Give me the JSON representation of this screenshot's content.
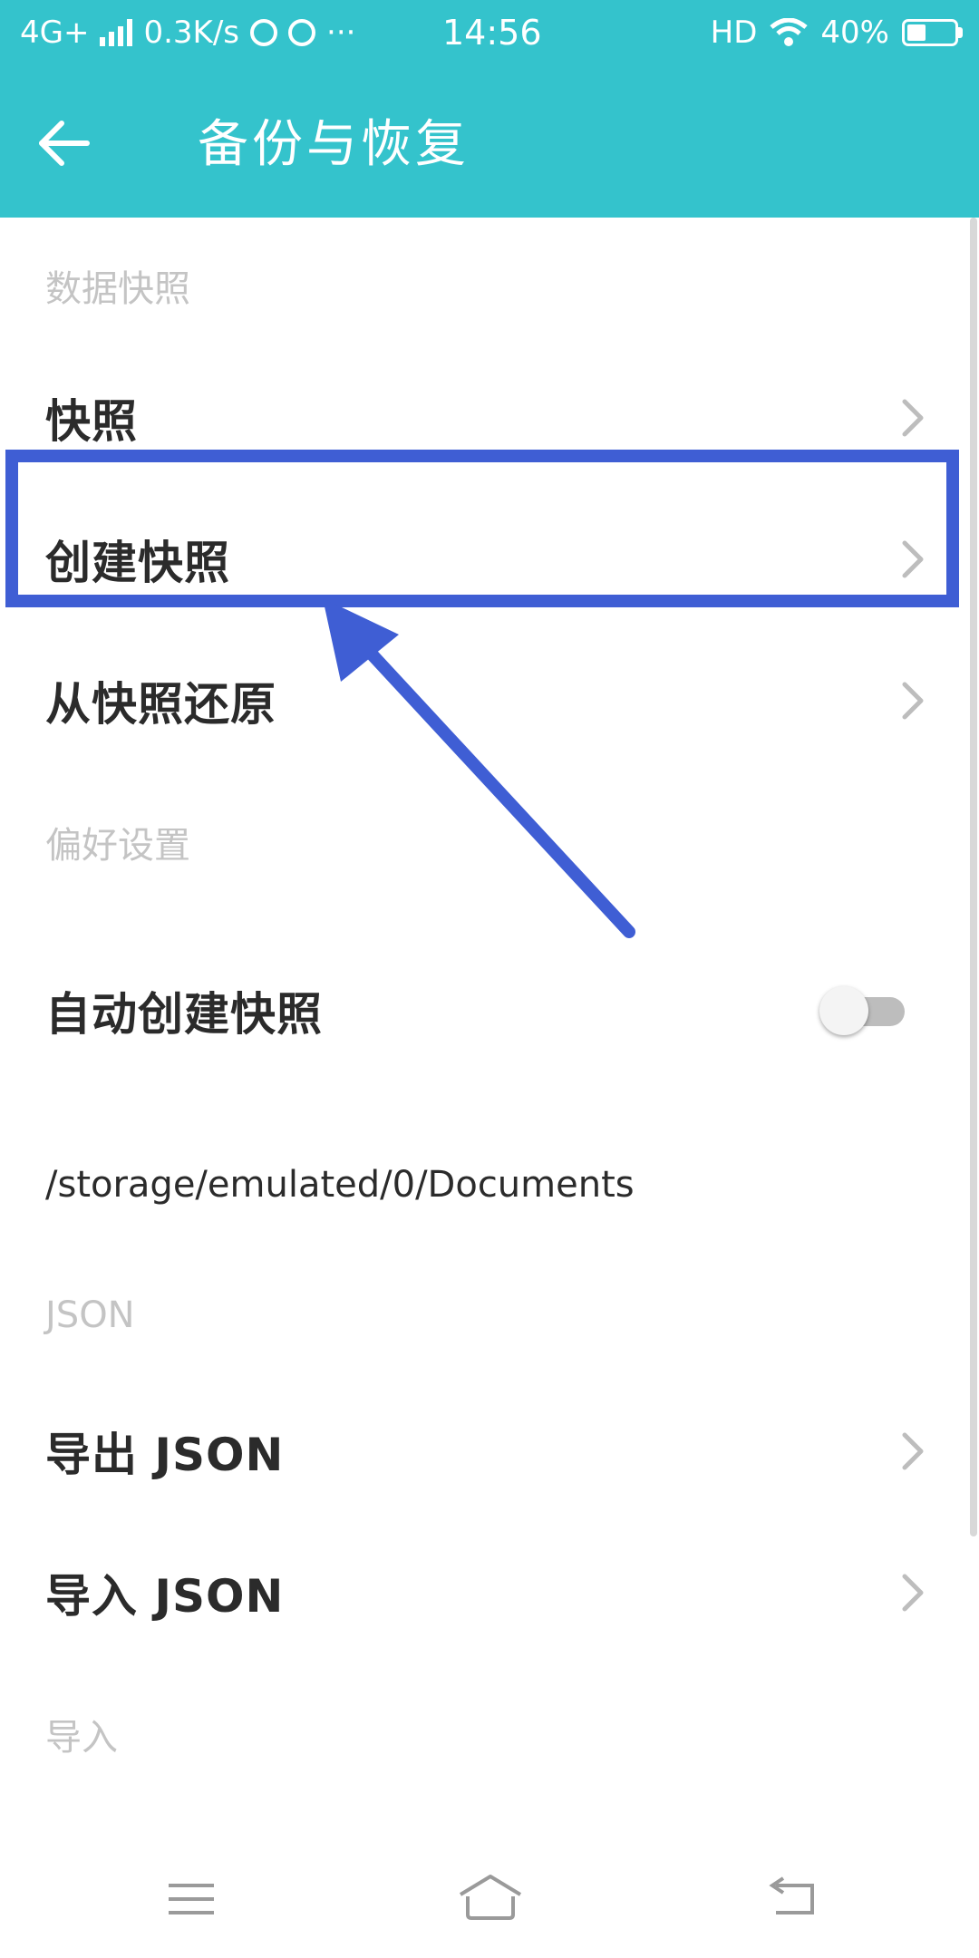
{
  "status_bar": {
    "network": "4G+",
    "speed": "0.3K/s",
    "more": "···",
    "time": "14:56",
    "hd": "HD",
    "battery": "40%"
  },
  "header": {
    "title": "备份与恢复"
  },
  "sections": {
    "snapshot_label": "数据快照",
    "preferences_label": "偏好设置",
    "json_label": "JSON",
    "import_label": "导入"
  },
  "items": {
    "snapshot": "快照",
    "create_snapshot": "创建快照",
    "restore_snapshot": "从快照还原",
    "auto_create_snapshot": "自动创建快照",
    "export_json": "导出 JSON",
    "import_json": "导入 JSON"
  },
  "storage_path": "/storage/emulated/0/Documents",
  "auto_snapshot_enabled": false,
  "colors": {
    "header_bg": "#34c3cc",
    "highlight": "#3f5ed4",
    "section_label": "#c4c4c4"
  },
  "icons": [
    "back-arrow-icon",
    "chevron-right-icon",
    "menu-icon",
    "home-icon",
    "back-nav-icon"
  ]
}
